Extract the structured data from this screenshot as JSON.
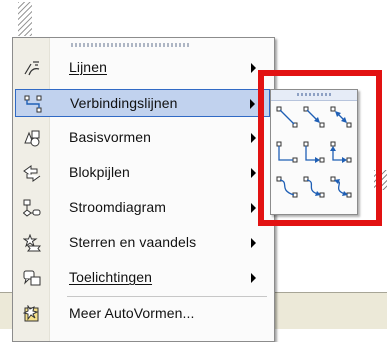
{
  "menu": {
    "items": [
      {
        "label": "Lijnen",
        "icon": "lines-icon",
        "submenu": true,
        "selected": false
      },
      {
        "label": "Verbindingslijnen",
        "icon": "connectors-icon",
        "submenu": true,
        "selected": true
      },
      {
        "label": "Basisvormen",
        "icon": "basic-shapes-icon",
        "submenu": true,
        "selected": false
      },
      {
        "label": "Blokpijlen",
        "icon": "block-arrows-icon",
        "submenu": true,
        "selected": false
      },
      {
        "label": "Stroomdiagram",
        "icon": "flowchart-icon",
        "submenu": true,
        "selected": false
      },
      {
        "label": "Sterren en vaandels",
        "icon": "stars-banners-icon",
        "submenu": true,
        "selected": false
      },
      {
        "label": "Toelichtingen",
        "icon": "callouts-icon",
        "submenu": true,
        "selected": false
      },
      {
        "label": "Meer AutoVormen...",
        "icon": "more-autoshapes-icon",
        "submenu": false,
        "selected": false
      }
    ]
  },
  "connector_submenu": {
    "items": [
      "straight-connector-icon",
      "straight-arrow-connector-icon",
      "straight-double-arrow-connector-icon",
      "elbow-connector-icon",
      "elbow-arrow-connector-icon",
      "elbow-double-arrow-connector-icon",
      "curved-connector-icon",
      "curved-arrow-connector-icon",
      "curved-double-arrow-connector-icon"
    ]
  },
  "colors": {
    "highlight_fill": "#c1d2ee",
    "highlight_border": "#316ac5",
    "annotation_box": "#e21212"
  }
}
